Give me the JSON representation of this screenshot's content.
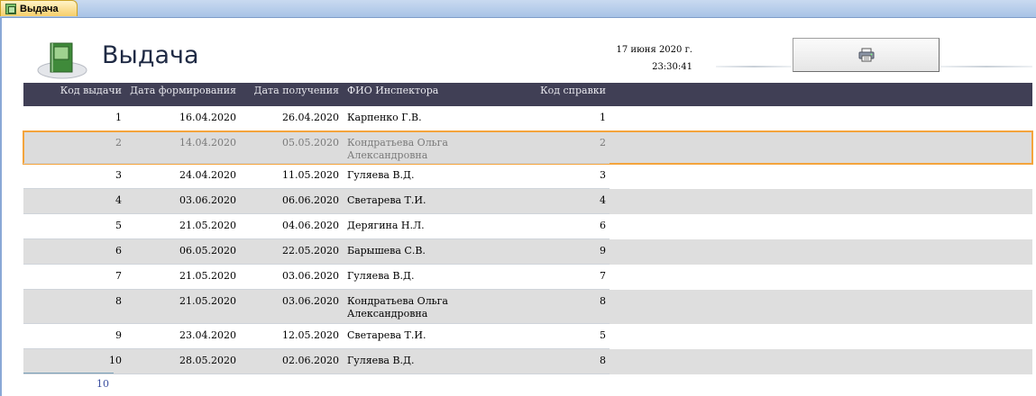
{
  "window": {
    "tab_label": "Выдача"
  },
  "report": {
    "title": "Выдача",
    "date": "17 июня 2020 г.",
    "time": "23:30:41"
  },
  "icons": {
    "print": "printer-icon",
    "logo": "notebook-icon",
    "tab": "report-icon"
  },
  "columns": [
    "Код выдачи",
    "Дата формирования",
    "Дата получения",
    "ФИО Инспектора",
    "Код справки"
  ],
  "rows": [
    {
      "id": "1",
      "formed": "16.04.2020",
      "received": "26.04.2020",
      "inspector": "Карпенко Г.В.",
      "ref": "1"
    },
    {
      "id": "2",
      "formed": "14.04.2020",
      "received": "05.05.2020",
      "inspector": "Кондратьева Ольга Александровна",
      "ref": "2"
    },
    {
      "id": "3",
      "formed": "24.04.2020",
      "received": "11.05.2020",
      "inspector": "Гуляева В.Д.",
      "ref": "3"
    },
    {
      "id": "4",
      "formed": "03.06.2020",
      "received": "06.06.2020",
      "inspector": "Светарева Т.И.",
      "ref": "4"
    },
    {
      "id": "5",
      "formed": "21.05.2020",
      "received": "04.06.2020",
      "inspector": "Дерягина Н.Л.",
      "ref": "6"
    },
    {
      "id": "6",
      "formed": "06.05.2020",
      "received": "22.05.2020",
      "inspector": "Барышева С.В.",
      "ref": "9"
    },
    {
      "id": "7",
      "formed": "21.05.2020",
      "received": "03.06.2020",
      "inspector": "Гуляева В.Д.",
      "ref": "7"
    },
    {
      "id": "8",
      "formed": "21.05.2020",
      "received": "03.06.2020",
      "inspector": "Кондратьева Ольга Александровна",
      "ref": "8"
    },
    {
      "id": "9",
      "formed": "23.04.2020",
      "received": "12.05.2020",
      "inspector": "Светарева Т.И.",
      "ref": "5"
    },
    {
      "id": "10",
      "formed": "28.05.2020",
      "received": "02.06.2020",
      "inspector": "Гуляева В.Д.",
      "ref": "8"
    }
  ],
  "footer": {
    "count": "10"
  },
  "colors": {
    "header_bar": "#403f55",
    "alt_row": "#dedede",
    "selection": "#f4a43c"
  }
}
